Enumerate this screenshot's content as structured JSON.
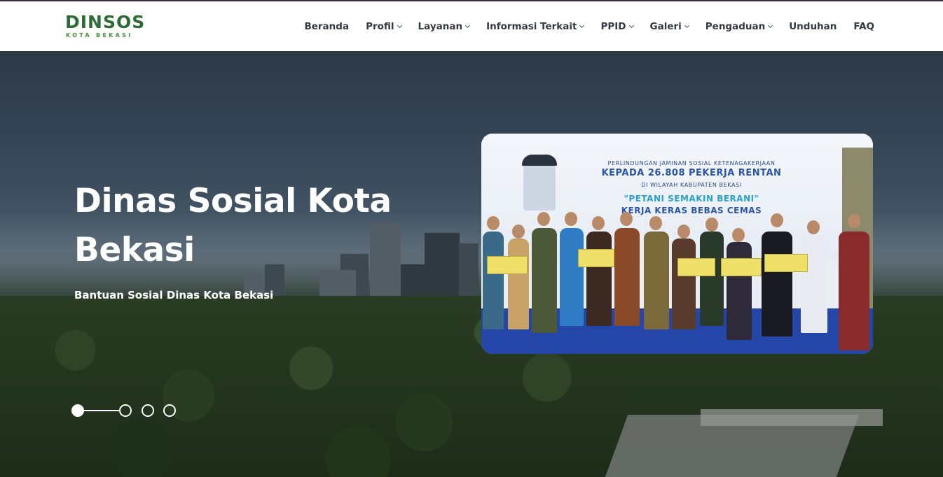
{
  "brand": {
    "logo_main": "DINSOS",
    "logo_sub": "KOTA BEKASI"
  },
  "nav": {
    "items": [
      {
        "label": "Beranda",
        "dropdown": false
      },
      {
        "label": "Profil",
        "dropdown": true
      },
      {
        "label": "Layanan",
        "dropdown": true
      },
      {
        "label": "Informasi Terkait",
        "dropdown": true
      },
      {
        "label": "PPID",
        "dropdown": true
      },
      {
        "label": "Galeri",
        "dropdown": true
      },
      {
        "label": "Pengaduan",
        "dropdown": true
      },
      {
        "label": "Unduhan",
        "dropdown": false
      },
      {
        "label": "FAQ",
        "dropdown": false
      }
    ]
  },
  "hero": {
    "title": "Dinas Sosial Kota Bekasi",
    "subtitle": "Bantuan Sosial Dinas Kota Bekasi"
  },
  "slide_photo": {
    "banner_line1": "PERLINDUNGAN JAMINAN SOSIAL KETENAGAKERJAAN",
    "banner_line2": "KEPADA 26.808 PEKERJA RENTAN",
    "banner_line3": "DI WILAYAH KABUPATEN BEKASI",
    "banner_line4": "\"PETANI SEMAKIN BERANI\"",
    "banner_line5": "KERJA KERAS BEBAS CEMAS"
  },
  "slider": {
    "count": 4,
    "active_index": 0
  },
  "colors": {
    "brand_green": "#2e6b35",
    "nav_text": "#343a40",
    "hero_text": "#ffffff"
  }
}
